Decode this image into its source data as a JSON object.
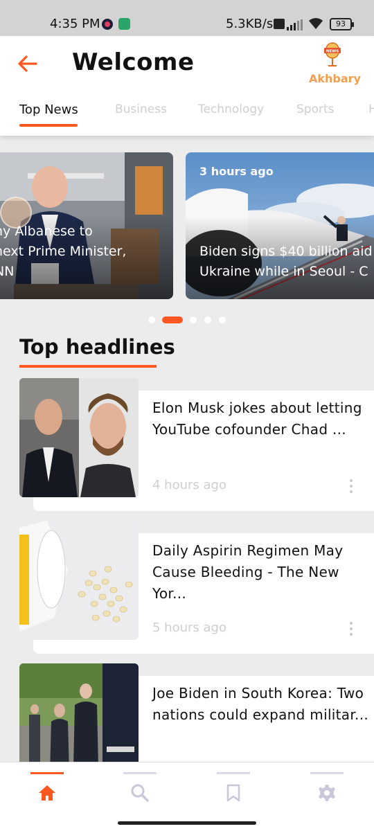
{
  "status_bar": {
    "time": "4:35 PM",
    "network_speed": "5.3KB/s",
    "battery": "93"
  },
  "header": {
    "title": "Welcome",
    "logo_badge": "NEWS",
    "logo_text": "Akhbary"
  },
  "tabs": [
    {
      "label": "Top News",
      "active": true
    },
    {
      "label": "Business",
      "active": false
    },
    {
      "label": "Technology",
      "active": false
    },
    {
      "label": "Sports",
      "active": false
    },
    {
      "label": "H",
      "active": false
    }
  ],
  "carousel": {
    "cards": [
      {
        "time": "",
        "title_lines": [
          "ny Albanese to",
          "next Prime Minister,",
          "NN"
        ]
      },
      {
        "time": "3 hours ago",
        "title_lines": [
          "Biden signs $40 billion aid",
          "Ukraine while in Seoul - C"
        ]
      }
    ],
    "active_index": 1,
    "dot_count": 5
  },
  "headlines": {
    "title": "Top headlines",
    "items": [
      {
        "title_lines": [
          "Elon Musk jokes about letting",
          "YouTube cofounder Chad ..."
        ],
        "time": "4 hours ago"
      },
      {
        "title_lines": [
          "Daily Aspirin Regimen May",
          "Cause Bleeding - The New Yor..."
        ],
        "time": "5 hours ago"
      },
      {
        "title_lines": [
          "Joe Biden in South Korea: Two",
          "nations could expand militar..."
        ],
        "time": ""
      }
    ]
  },
  "bottom_nav": [
    {
      "icon": "home-icon",
      "active": true
    },
    {
      "icon": "search-icon",
      "active": false
    },
    {
      "icon": "bookmark-icon",
      "active": false
    },
    {
      "icon": "settings-icon",
      "active": false
    }
  ],
  "colors": {
    "accent": "#ff5722",
    "logo": "#f0a050",
    "background": "#ececec",
    "inactive_icon": "#c8c8d8"
  }
}
